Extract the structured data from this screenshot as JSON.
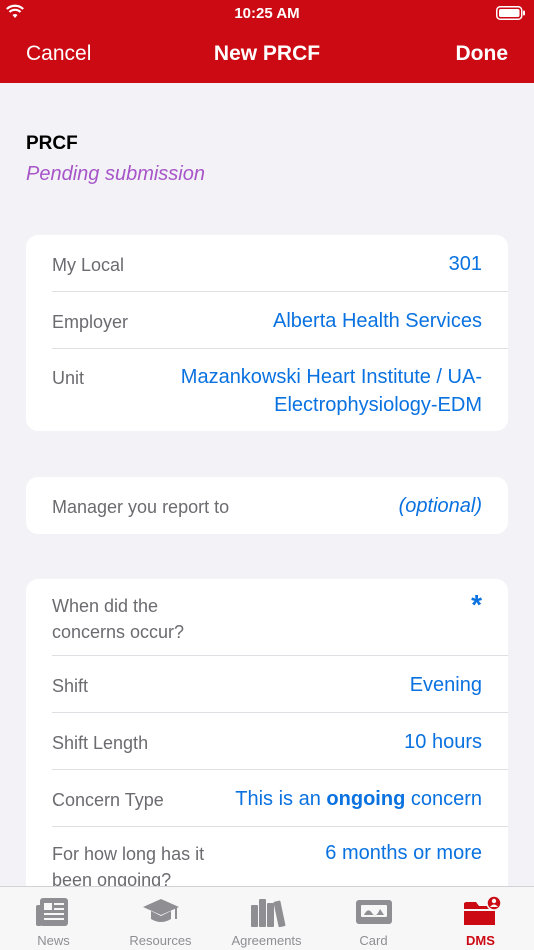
{
  "status_bar": {
    "time": "10:25 AM"
  },
  "nav": {
    "cancel": "Cancel",
    "title": "New PRCF",
    "done": "Done"
  },
  "form": {
    "title": "PRCF",
    "status": "Pending submission"
  },
  "section1": {
    "rows": [
      {
        "label": "My Local",
        "value": "301"
      },
      {
        "label": "Employer",
        "value": "Alberta Health Services"
      },
      {
        "label": "Unit",
        "value_line1": "Mazankowski Heart Institute / UA-",
        "value_line2": "Electrophysiology-EDM"
      }
    ]
  },
  "section2": {
    "label": "Manager you report to",
    "value": "(optional)"
  },
  "section3": {
    "when_label_line1": "When did the",
    "when_label_line2": "concerns occur?",
    "when_required": "*",
    "shift_label": "Shift",
    "shift_value": "Evening",
    "shift_length_label": "Shift Length",
    "shift_length_value": "10 hours",
    "concern_type_label": "Concern Type",
    "concern_type_prefix": "This is an ",
    "concern_type_bold": "ongoing",
    "concern_type_suffix": " concern",
    "ongoing_label_line1": "For how long has it",
    "ongoing_label_line2": "been ongoing?",
    "ongoing_value": "6 months or more"
  },
  "tabbar": {
    "tabs": [
      {
        "label": "News",
        "icon": "newspaper-icon"
      },
      {
        "label": "Resources",
        "icon": "graduation-cap-icon"
      },
      {
        "label": "Agreements",
        "icon": "books-icon"
      },
      {
        "label": "Card",
        "icon": "card-icon"
      },
      {
        "label": "DMS",
        "icon": "folder-person-icon"
      }
    ],
    "active": "DMS"
  },
  "colors": {
    "brand_red": "#cc0a14",
    "link_blue": "#0a72e0",
    "status_purple": "#a855c8"
  }
}
